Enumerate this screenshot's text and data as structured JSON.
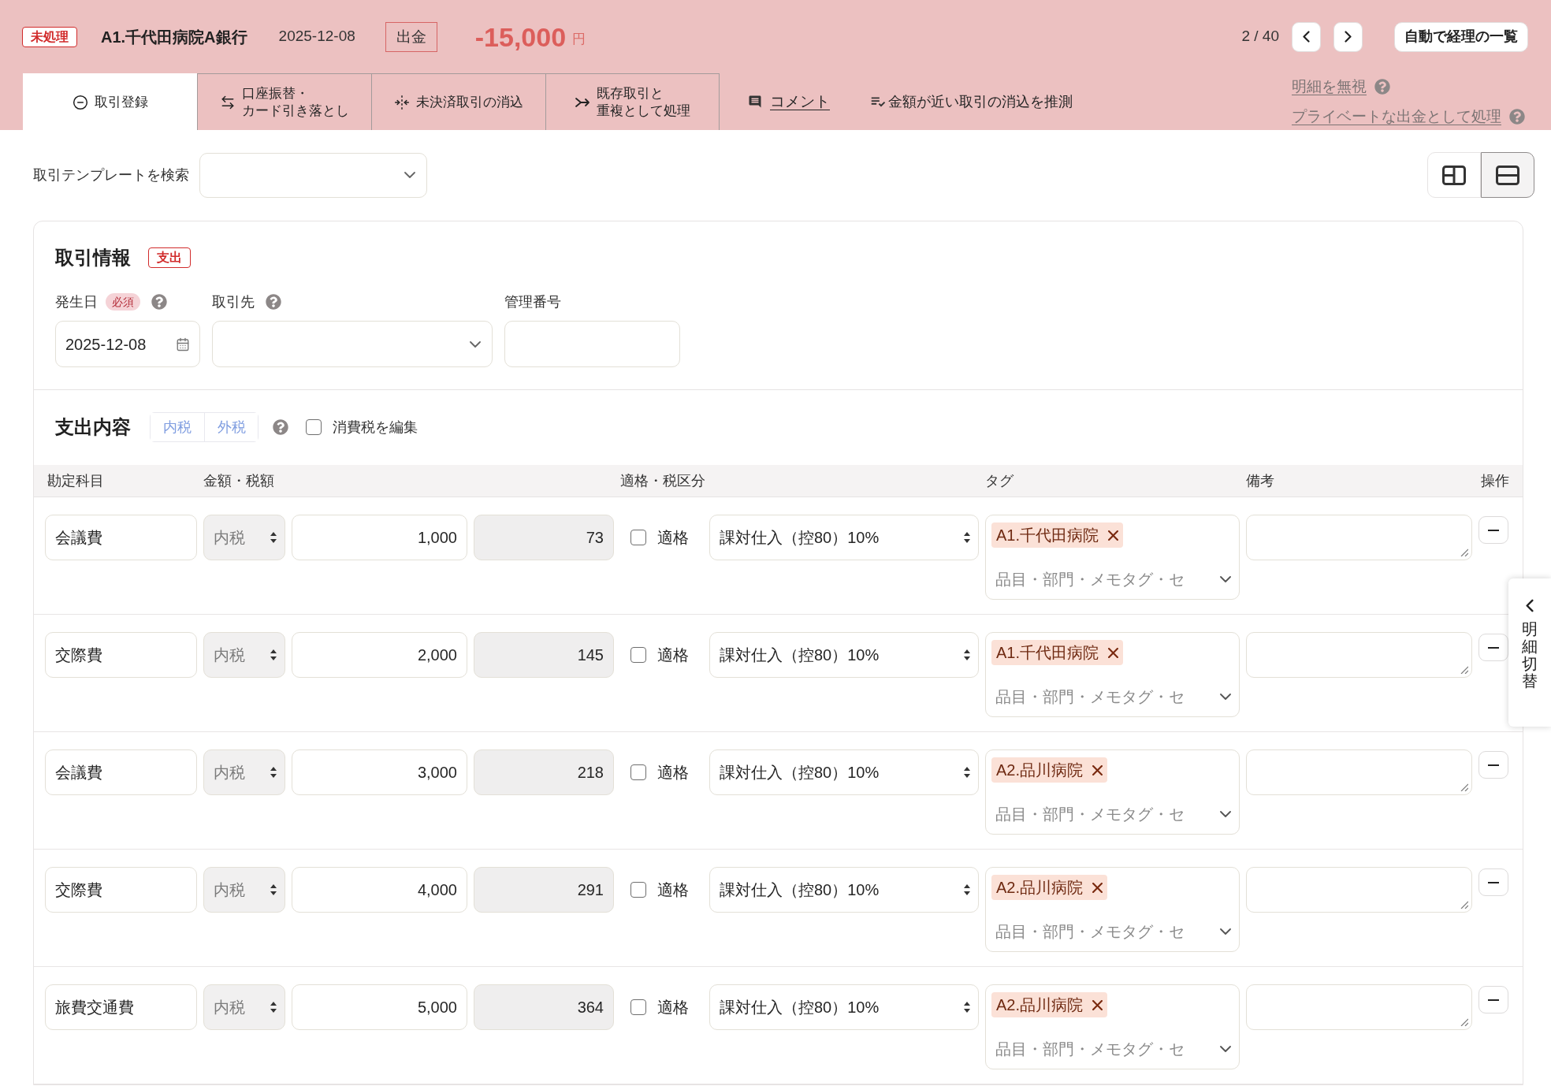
{
  "header": {
    "status_badge": "未処理",
    "account": "A1.千代田病院A銀行",
    "date": "2025-12-08",
    "direction": "出金",
    "amount": "-15,000",
    "currency": "円",
    "pager": "2 / 40",
    "list_button": "自動で経理の一覧"
  },
  "tabs": [
    {
      "lines": [
        "取引登録"
      ],
      "selected": true
    },
    {
      "lines": [
        "口座振替・",
        "カード引き落とし"
      ],
      "selected": false
    },
    {
      "lines": [
        "未決済取引の消込"
      ],
      "selected": false
    },
    {
      "lines": [
        "既存取引と",
        "重複として処理"
      ],
      "selected": false
    }
  ],
  "actions": [
    {
      "label": "コメント",
      "kind": "link"
    },
    {
      "label": "金額が近い取引の消込を推測",
      "kind": "button"
    }
  ],
  "side_links": [
    "明細を無視",
    "プライベートな出金として処理"
  ],
  "template_search": {
    "label": "取引テンプレートを検索"
  },
  "view_toggle": [
    {
      "selected": false
    },
    {
      "selected": true
    }
  ],
  "transaction_info": {
    "title": "取引情報",
    "type_badge": "支出",
    "fields": [
      {
        "kind": "date",
        "label": "発生日",
        "required_badge": "必須",
        "help": true,
        "value": "2025-12-08"
      },
      {
        "kind": "select",
        "label": "取引先",
        "help": true
      },
      {
        "kind": "text",
        "label": "管理番号",
        "help": false
      }
    ]
  },
  "expenses": {
    "title": "支出内容",
    "tax_modes": [
      {
        "label": "内税",
        "selected": false
      },
      {
        "label": "外税",
        "selected": false
      }
    ],
    "edit_tax": {
      "label": "消費税を編集",
      "checked": false
    },
    "columns": [
      "勘定科目",
      "金額・税額",
      "適格・税区分",
      "タグ",
      "備考",
      "操作"
    ],
    "rows": [
      {
        "account": "会議費",
        "tax_mode": "内税",
        "amount": "1,000",
        "tax": "73",
        "qualified": {
          "label": "適格",
          "checked": false
        },
        "tax_category": "課対仕入（控80）10%",
        "tags": {
          "items": [
            "A1.千代田病院"
          ],
          "placeholder": "品目・部門・メモタグ・セ"
        }
      },
      {
        "account": "交際費",
        "tax_mode": "内税",
        "amount": "2,000",
        "tax": "145",
        "qualified": {
          "label": "適格",
          "checked": false
        },
        "tax_category": "課対仕入（控80）10%",
        "tags": {
          "items": [
            "A1.千代田病院"
          ],
          "placeholder": "品目・部門・メモタグ・セ"
        }
      },
      {
        "account": "会議費",
        "tax_mode": "内税",
        "amount": "3,000",
        "tax": "218",
        "qualified": {
          "label": "適格",
          "checked": false
        },
        "tax_category": "課対仕入（控80）10%",
        "tags": {
          "items": [
            "A2.品川病院"
          ],
          "placeholder": "品目・部門・メモタグ・セ"
        }
      },
      {
        "account": "交際費",
        "tax_mode": "内税",
        "amount": "4,000",
        "tax": "291",
        "qualified": {
          "label": "適格",
          "checked": false
        },
        "tax_category": "課対仕入（控80）10%",
        "tags": {
          "items": [
            "A2.品川病院"
          ],
          "placeholder": "品目・部門・メモタグ・セ"
        }
      },
      {
        "account": "旅費交通費",
        "tax_mode": "内税",
        "amount": "5,000",
        "tax": "364",
        "qualified": {
          "label": "適格",
          "checked": false
        },
        "tax_category": "課対仕入（控80）10%",
        "tags": {
          "items": [
            "A2.品川病院"
          ],
          "placeholder": "品目・部門・メモタグ・セ"
        }
      }
    ]
  },
  "side_tab": {
    "label": "明細切替"
  }
}
